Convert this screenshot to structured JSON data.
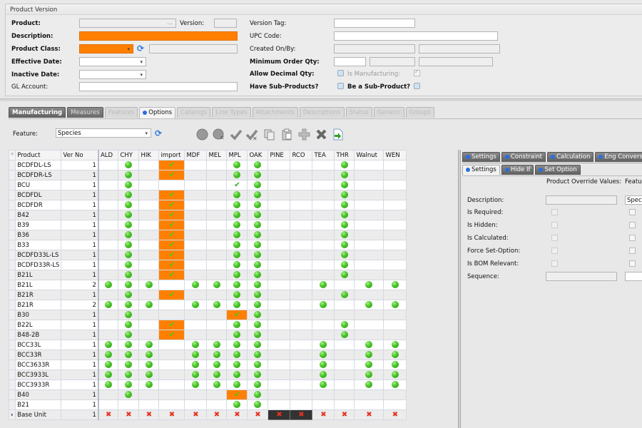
{
  "panel": {
    "title": "Product Version",
    "fields": {
      "product": {
        "label": "Product:",
        "value": ""
      },
      "version": {
        "label": "Version:",
        "value": ""
      },
      "description": {
        "label": "Description:",
        "value": ""
      },
      "product_class": {
        "label": "Product Class:",
        "value": ""
      },
      "effective_date": {
        "label": "Effective Date:",
        "value": ""
      },
      "inactive_date": {
        "label": "Inactive Date:",
        "value": ""
      },
      "gl_account": {
        "label": "GL Account:",
        "value": ""
      },
      "version_tag": {
        "label": "Version Tag:",
        "value": ""
      },
      "upc_code": {
        "label": "UPC Code:",
        "value": ""
      },
      "created_on_by": {
        "label": "Created On/By:",
        "value": ""
      },
      "min_order_qty": {
        "label": "Minimum Order Qty:",
        "value": ""
      },
      "allow_decimal_qty": {
        "label": "Allow Decimal Qty:",
        "checked": false
      },
      "is_manufacturing": {
        "label": "Is Manufacturing:",
        "checked": true
      },
      "have_sub_products": {
        "label": "Have Sub-Products?",
        "checked": false
      },
      "be_sub_product": {
        "label": "Be a Sub-Product?",
        "checked": false
      }
    }
  },
  "tabs": [
    {
      "label": "Manufacturing",
      "state": "dark"
    },
    {
      "label": "Measures",
      "state": "dark2"
    },
    {
      "label": "Features",
      "state": "disabled"
    },
    {
      "label": "Options",
      "state": "active"
    },
    {
      "label": "Catalogs",
      "state": "disabled"
    },
    {
      "label": "Line Types",
      "state": "disabled"
    },
    {
      "label": "Attachments",
      "state": "disabled"
    },
    {
      "label": "Descriptions",
      "state": "disabled"
    },
    {
      "label": "Status",
      "state": "disabled"
    },
    {
      "label": "Generic",
      "state": "disabled"
    },
    {
      "label": "Groups",
      "state": "disabled"
    }
  ],
  "feature": {
    "label": "Feature:",
    "value": "Species"
  },
  "toolbar_icons": [
    "circle-icon",
    "circle-delete-icon",
    "check-icon",
    "check-delete-icon",
    "copy-icon",
    "paste-icon",
    "add-icon",
    "delete-icon",
    "export-icon"
  ],
  "grid": {
    "columns": [
      "Product",
      "Ver No",
      "ALD",
      "CHY",
      "HIK",
      "import",
      "MDF",
      "MEL",
      "MPL",
      "OAK",
      "PINE",
      "RCO",
      "TEA",
      "THR",
      "Walnut",
      "WEN"
    ],
    "legend": {
      "g": "available",
      "o": "default-checked",
      "c": "checked",
      "x": "not-available",
      "xd": "not-available-selected"
    },
    "rows": [
      {
        "product": "BCDFDL-LS",
        "ver": "1",
        "cells": [
          "",
          "g",
          "",
          "o",
          "",
          "",
          "g",
          "g",
          "",
          "",
          "",
          "g",
          "",
          ""
        ]
      },
      {
        "product": "BCDFDR-LS",
        "ver": "1",
        "cells": [
          "",
          "g",
          "",
          "o",
          "",
          "",
          "g",
          "g",
          "",
          "",
          "",
          "g",
          "",
          ""
        ]
      },
      {
        "product": "BCU",
        "ver": "1",
        "cells": [
          "",
          "g",
          "",
          "",
          "",
          "",
          "c",
          "g",
          "",
          "",
          "",
          "g",
          "",
          ""
        ]
      },
      {
        "product": "BCDFDL",
        "ver": "1",
        "cells": [
          "",
          "g",
          "",
          "o",
          "",
          "",
          "g",
          "g",
          "",
          "",
          "",
          "g",
          "",
          ""
        ]
      },
      {
        "product": "BCDFDR",
        "ver": "1",
        "cells": [
          "",
          "g",
          "",
          "o",
          "",
          "",
          "g",
          "g",
          "",
          "",
          "",
          "g",
          "",
          ""
        ]
      },
      {
        "product": "B42",
        "ver": "1",
        "cells": [
          "",
          "g",
          "",
          "o",
          "",
          "",
          "g",
          "g",
          "",
          "",
          "",
          "g",
          "",
          ""
        ]
      },
      {
        "product": "B39",
        "ver": "1",
        "cells": [
          "",
          "g",
          "",
          "o",
          "",
          "",
          "g",
          "g",
          "",
          "",
          "",
          "g",
          "",
          ""
        ]
      },
      {
        "product": "B36",
        "ver": "1",
        "cells": [
          "",
          "g",
          "",
          "o",
          "",
          "",
          "g",
          "g",
          "",
          "",
          "",
          "g",
          "",
          ""
        ]
      },
      {
        "product": "B33",
        "ver": "1",
        "cells": [
          "",
          "g",
          "",
          "o",
          "",
          "",
          "g",
          "g",
          "",
          "",
          "",
          "g",
          "",
          ""
        ]
      },
      {
        "product": "BCDFD33L-LS",
        "ver": "1",
        "cells": [
          "",
          "g",
          "",
          "o",
          "",
          "",
          "g",
          "g",
          "",
          "",
          "",
          "g",
          "",
          ""
        ]
      },
      {
        "product": "BCDFD33R-LS",
        "ver": "1",
        "cells": [
          "",
          "g",
          "",
          "o",
          "",
          "",
          "g",
          "g",
          "",
          "",
          "",
          "g",
          "",
          ""
        ]
      },
      {
        "product": "B21L",
        "ver": "1",
        "cells": [
          "",
          "g",
          "",
          "o",
          "",
          "",
          "g",
          "g",
          "",
          "",
          "",
          "g",
          "",
          ""
        ]
      },
      {
        "product": "B21L",
        "ver": "2",
        "cells": [
          "g",
          "g",
          "g",
          "",
          "g",
          "g",
          "g",
          "g",
          "",
          "",
          "g",
          "",
          "g",
          "g"
        ]
      },
      {
        "product": "B21R",
        "ver": "1",
        "cells": [
          "",
          "g",
          "",
          "o",
          "",
          "",
          "g",
          "g",
          "",
          "",
          "",
          "g",
          "",
          ""
        ]
      },
      {
        "product": "B21R",
        "ver": "2",
        "cells": [
          "g",
          "g",
          "g",
          "",
          "g",
          "g",
          "g",
          "g",
          "",
          "",
          "g",
          "",
          "g",
          "g"
        ]
      },
      {
        "product": "B30",
        "ver": "1",
        "cells": [
          "",
          "g",
          "",
          "",
          "",
          "",
          "o",
          "g",
          "",
          "",
          "",
          "",
          "",
          ""
        ]
      },
      {
        "product": "B22L",
        "ver": "1",
        "cells": [
          "",
          "g",
          "",
          "o",
          "",
          "",
          "g",
          "g",
          "",
          "",
          "",
          "g",
          "",
          ""
        ]
      },
      {
        "product": "B48-2B",
        "ver": "1",
        "cells": [
          "",
          "g",
          "",
          "o",
          "",
          "",
          "g",
          "g",
          "",
          "",
          "",
          "g",
          "",
          ""
        ]
      },
      {
        "product": "BCC33L",
        "ver": "1",
        "cells": [
          "g",
          "g",
          "g",
          "",
          "g",
          "g",
          "g",
          "g",
          "",
          "",
          "g",
          "",
          "g",
          "g"
        ]
      },
      {
        "product": "BCC33R",
        "ver": "1",
        "cells": [
          "g",
          "g",
          "g",
          "",
          "g",
          "g",
          "g",
          "g",
          "",
          "",
          "g",
          "",
          "g",
          "g"
        ]
      },
      {
        "product": "BCC3633R",
        "ver": "1",
        "cells": [
          "g",
          "g",
          "g",
          "",
          "g",
          "g",
          "g",
          "g",
          "",
          "",
          "g",
          "",
          "g",
          "g"
        ]
      },
      {
        "product": "BCC3933L",
        "ver": "1",
        "cells": [
          "g",
          "g",
          "g",
          "",
          "g",
          "g",
          "g",
          "g",
          "",
          "",
          "g",
          "",
          "g",
          "g"
        ]
      },
      {
        "product": "BCC3933R",
        "ver": "1",
        "cells": [
          "g",
          "g",
          "g",
          "",
          "g",
          "g",
          "g",
          "g",
          "",
          "",
          "g",
          "",
          "g",
          "g"
        ]
      },
      {
        "product": "B40",
        "ver": "1",
        "cells": [
          "",
          "g",
          "",
          "",
          "",
          "",
          "o",
          "g",
          "",
          "",
          "",
          "",
          "",
          ""
        ]
      },
      {
        "product": "B21",
        "ver": "1",
        "cells": [
          "",
          "",
          "",
          "",
          "",
          "",
          "g",
          "g",
          "",
          "",
          "",
          "",
          "",
          ""
        ]
      },
      {
        "product": "Base Unit",
        "ver": "1",
        "current": true,
        "cells": [
          "x",
          "x",
          "x",
          "x",
          "x",
          "x",
          "x",
          "x",
          "xd",
          "xd",
          "x",
          "x",
          "x",
          "x"
        ]
      }
    ]
  },
  "right_panel": {
    "tabs_top": [
      "Settings",
      "Constraint",
      "Calculation",
      "Eng Conversion"
    ],
    "tabs_sub": [
      "Settings",
      "Hide If",
      "Set Option"
    ],
    "col_override": "Product Override Values:",
    "col_feature": "Feature",
    "rows": [
      {
        "label": "Description:",
        "type": "text",
        "override": "",
        "feature": "Species"
      },
      {
        "label": "Is Required:",
        "type": "check"
      },
      {
        "label": "Is Hidden:",
        "type": "check"
      },
      {
        "label": "Is Calculated:",
        "type": "check"
      },
      {
        "label": "Force Set-Option:",
        "type": "check"
      },
      {
        "label": "Is BOM Relevant:",
        "type": "check"
      },
      {
        "label": "Sequence:",
        "type": "text",
        "override": "",
        "feature": ""
      }
    ]
  },
  "colors": {
    "required": "#ff8000",
    "available": "#48c428",
    "error": "#e83020"
  }
}
